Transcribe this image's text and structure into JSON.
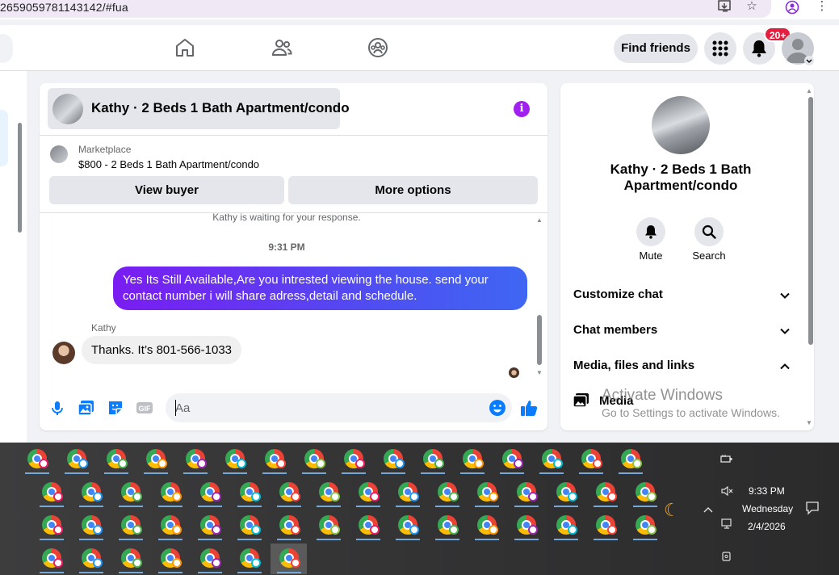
{
  "browser": {
    "url_fragment": "2659059781143142/#fua"
  },
  "nav": {
    "find_friends_label": "Find friends",
    "notif_badge": "20+"
  },
  "chat": {
    "title": "Kathy · 2 Beds 1 Bath Apartment/condo",
    "marketplace_label": "Marketplace",
    "listing": "$800 - 2 Beds 1 Bath Apartment/condo",
    "view_buyer_label": "View buyer",
    "more_options_label": "More options",
    "waiting_text": "Kathy is waiting for your response.",
    "timestamp": "9:31 PM",
    "outgoing_message": "Yes Its Still Available,Are you intrested viewing the house. send your contact number i will share adress,detail and schedule.",
    "incoming_sender": "Kathy",
    "incoming_message": "Thanks. It’s 801-566-1033",
    "input_placeholder": "Aa",
    "accent_color": "#0a7cff"
  },
  "info_panel": {
    "title": "Kathy · 2 Beds 1 Bath Apartment/condo",
    "mute_label": "Mute",
    "search_label": "Search",
    "sections": [
      {
        "label": "Customize chat",
        "expanded": false
      },
      {
        "label": "Chat members",
        "expanded": false
      },
      {
        "label": "Media, files and links",
        "expanded": true
      }
    ],
    "media_label": "Media"
  },
  "watermark": {
    "line1": "Activate Windows",
    "line2": "Go to Settings to activate Windows."
  },
  "taskbar": {
    "time": "9:33 PM",
    "day": "Wednesday",
    "date": "2/4/2026"
  }
}
